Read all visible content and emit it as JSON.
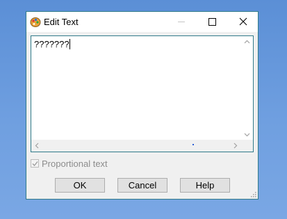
{
  "window": {
    "title": "Edit Text",
    "icon": "paint-palette-app-icon",
    "controls": {
      "minimize": "minimize-icon",
      "maximize": "maximize-icon",
      "close": "close-icon"
    }
  },
  "editor": {
    "text": "???????",
    "scrollbars": {
      "vertical": "up/down arrows",
      "horizontal": "left/right arrows"
    }
  },
  "options": {
    "proportional_text": {
      "label": "Proportional text",
      "checked": true,
      "enabled": false
    }
  },
  "buttons": {
    "ok": "OK",
    "cancel": "Cancel",
    "help": "Help"
  },
  "colors": {
    "accent_border": "#2f7a8a",
    "desktop": "#6f9fe0"
  }
}
